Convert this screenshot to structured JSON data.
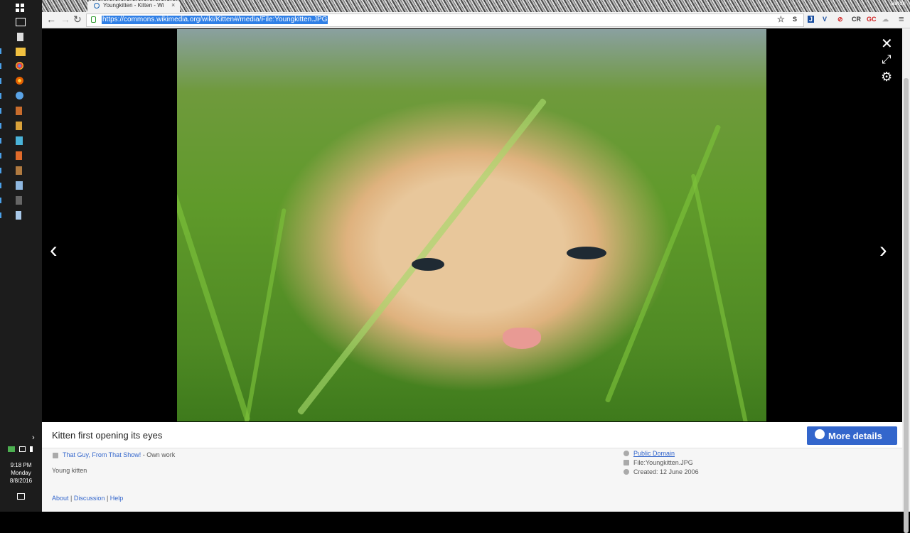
{
  "browser": {
    "tab_title": "Youngkitten - Kitten - Wi",
    "tab_close": "×",
    "url": "https://commons.wikimedia.org/wiki/Kitten#/media/File:Youngkitten.JPG",
    "back": "←",
    "forward": "→",
    "reload": "↻",
    "menu": "≡",
    "user": "aaron",
    "extensions": [
      "☆",
      "S",
      "J",
      "V",
      "⊘",
      "CR",
      "GC",
      "☁",
      "◐"
    ]
  },
  "viewer": {
    "close": "✕",
    "fullscreen": "⤢",
    "settings": "⚙",
    "prev": "‹",
    "next": "›"
  },
  "panel": {
    "caption": "Kitten first opening its eyes",
    "more_details": "More details",
    "author": "That Guy, From That Show!",
    "author_suffix": "- Own work",
    "description": "Young kitten",
    "license": "Public Domain",
    "file": "File:Youngkitten.JPG",
    "created": "Created: 12 June 2006",
    "footer": {
      "about": "About",
      "discussion": "Discussion",
      "help": "Help",
      "sep": "|"
    }
  },
  "taskbar": {
    "time": "9:18 PM",
    "day": "Monday",
    "date": "8/8/2016",
    "expand": "›"
  },
  "colors": {
    "accent": "#3366cc",
    "url_highlight": "#2f7fe6"
  }
}
